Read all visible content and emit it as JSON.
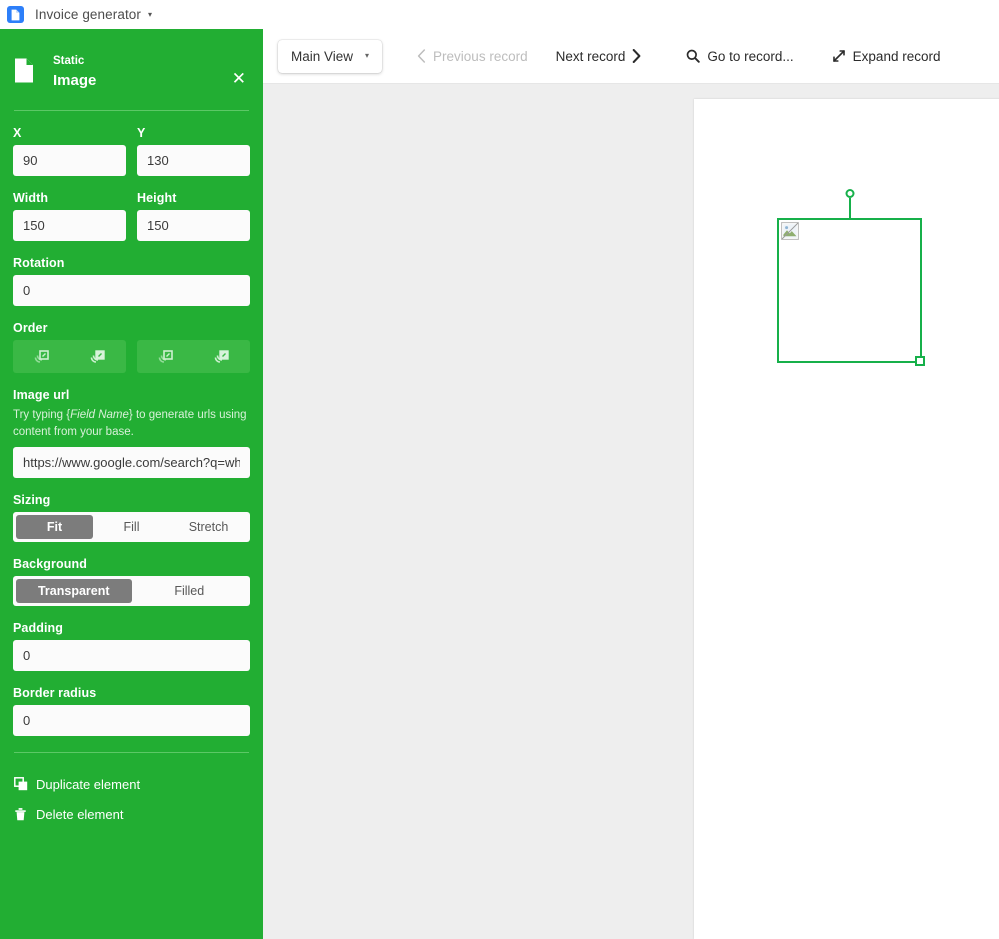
{
  "app_bar": {
    "icon": "document-app-icon",
    "title": "Invoice generator",
    "caret": "▾"
  },
  "panel": {
    "header": {
      "icon": "document-icon",
      "kind": "Static",
      "name": "Image",
      "close": "✕"
    },
    "fields": {
      "x_label": "X",
      "x_value": "90",
      "y_label": "Y",
      "y_value": "130",
      "width_label": "Width",
      "width_value": "150",
      "height_label": "Height",
      "height_value": "150",
      "rotation_label": "Rotation",
      "rotation_value": "0",
      "order_label": "Order",
      "image_url_label": "Image url",
      "image_url_helper_pre": "Try typing {",
      "image_url_helper_em": "Field Name",
      "image_url_helper_post": "} to generate urls using content from your base.",
      "image_url_value": "https://www.google.com/search?q=wh",
      "sizing_label": "Sizing",
      "background_label": "Background",
      "padding_label": "Padding",
      "padding_value": "0",
      "border_radius_label": "Border radius",
      "border_radius_value": "0"
    },
    "sizing_options": [
      {
        "label": "Fit",
        "active": true
      },
      {
        "label": "Fill",
        "active": false
      },
      {
        "label": "Stretch",
        "active": false
      }
    ],
    "background_options": [
      {
        "label": "Transparent",
        "active": true
      },
      {
        "label": "Filled",
        "active": false
      }
    ],
    "order_buttons": [
      {
        "name": "send-backward-icon"
      },
      {
        "name": "send-to-back-icon"
      },
      {
        "name": "bring-forward-icon"
      },
      {
        "name": "bring-to-front-icon"
      }
    ],
    "actions": [
      {
        "label": "Duplicate element",
        "icon": "duplicate-icon"
      },
      {
        "label": "Delete element",
        "icon": "trash-icon"
      }
    ]
  },
  "toolbar": {
    "view_label": "Main View",
    "view_caret": "▾",
    "previous_record": "Previous record",
    "next_record": "Next record",
    "go_to_record": "Go to record...",
    "expand_record": "Expand record"
  },
  "canvas": {
    "selected_element": "image-element",
    "placeholder": "broken-image-icon"
  },
  "colors": {
    "panel_green": "#22ae33",
    "accent_blue": "#2d7ff9",
    "selection_green": "#16b04a",
    "canvas_gray": "#eeeeee"
  }
}
